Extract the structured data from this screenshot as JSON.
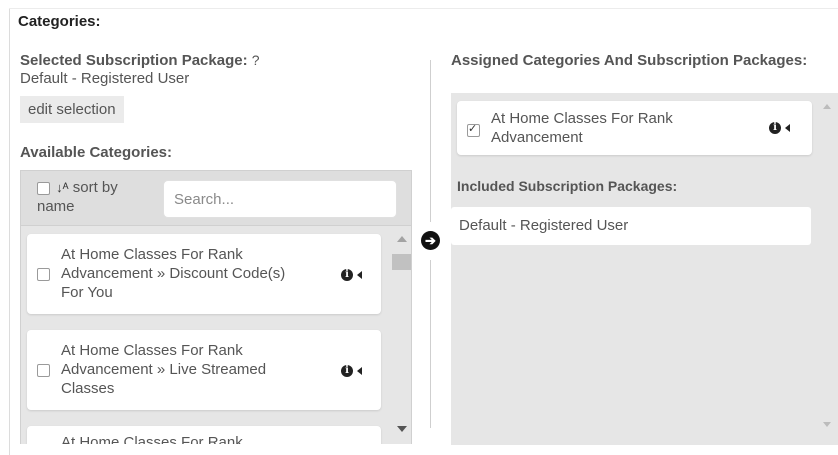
{
  "categories_title": "Categories:",
  "selected_package": {
    "label": "Selected Subscription Package:",
    "help_icon": "question-circle-icon",
    "value": "Default - Registered User",
    "edit_button": "edit selection"
  },
  "available": {
    "heading": "Available Categories:",
    "sort_label": "sort by",
    "sort_label_2": "name",
    "sort_icon": "sort-alpha-icon",
    "search_placeholder": "Search...",
    "items": [
      {
        "line1": "At Home Classes For Rank",
        "line2": "Advancement » Discount Code(s)",
        "line3": "For You",
        "checked": false
      },
      {
        "line1": "At Home Classes For Rank",
        "line2": "Advancement » Live Streamed",
        "line3": "Classes",
        "checked": false
      },
      {
        "line1": "At Home Classes For Rank",
        "line2": "",
        "line3": "",
        "checked": false
      }
    ]
  },
  "assigned": {
    "heading": "Assigned Categories And Subscription Packages:",
    "items": [
      {
        "line1": "At Home Classes For Rank",
        "line2": "Advancement",
        "checked": true
      }
    ],
    "included_heading": "Included Subscription Packages:",
    "included_packages": [
      "Default - Registered User"
    ]
  },
  "icons": {
    "info": "info-circle-icon",
    "caret": "caret-left-icon",
    "move": "arrow-circle-right-icon"
  }
}
